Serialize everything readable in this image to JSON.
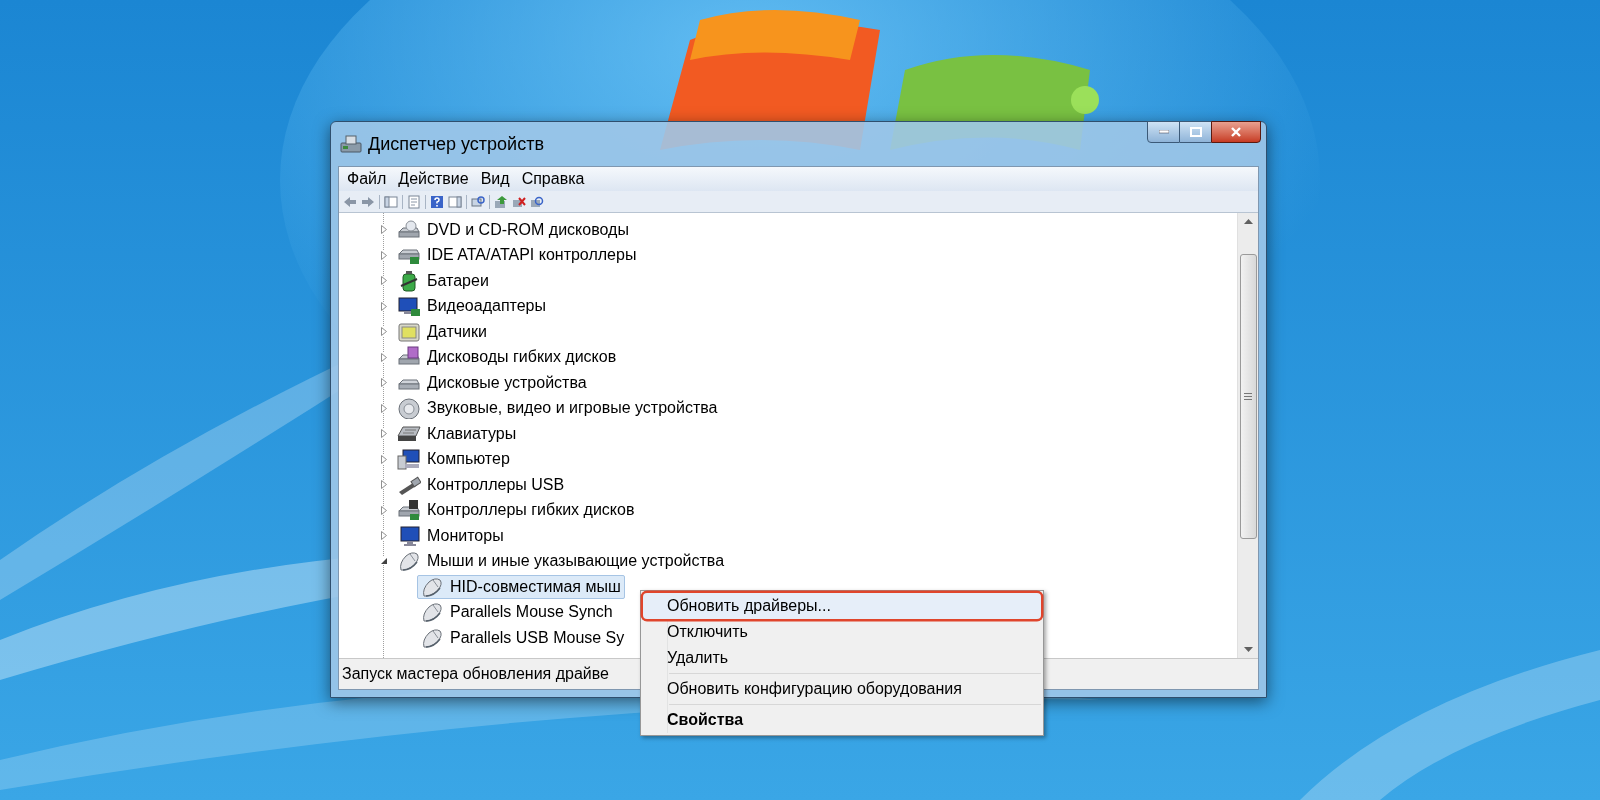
{
  "window": {
    "title": "Диспетчер устройств"
  },
  "menu_bar": [
    "Файл",
    "Действие",
    "Вид",
    "Справка"
  ],
  "tree": {
    "items": [
      {
        "label": "DVD и CD-ROM дисководы",
        "expanded": false,
        "selected": false
      },
      {
        "label": "IDE ATA/ATAPI контроллеры",
        "expanded": false,
        "selected": false
      },
      {
        "label": "Батареи",
        "expanded": false,
        "selected": false
      },
      {
        "label": "Видеоадаптеры",
        "expanded": false,
        "selected": false
      },
      {
        "label": "Датчики",
        "expanded": false,
        "selected": false
      },
      {
        "label": "Дисководы гибких дисков",
        "expanded": false,
        "selected": false
      },
      {
        "label": "Дисковые устройства",
        "expanded": false,
        "selected": false
      },
      {
        "label": "Звуковые, видео и игровые устройства",
        "expanded": false,
        "selected": false
      },
      {
        "label": "Клавиатуры",
        "expanded": false,
        "selected": false
      },
      {
        "label": "Компьютер",
        "expanded": false,
        "selected": false
      },
      {
        "label": "Контроллеры USB",
        "expanded": false,
        "selected": false
      },
      {
        "label": "Контроллеры гибких дисков",
        "expanded": false,
        "selected": false
      },
      {
        "label": "Мониторы",
        "expanded": false,
        "selected": false
      },
      {
        "label": "Мыши и иные указывающие устройства",
        "expanded": true,
        "selected": false,
        "children": [
          {
            "label": "HID-совместимая мыш",
            "selected": true
          },
          {
            "label": "Parallels Mouse Synch",
            "selected": false
          },
          {
            "label": "Parallels USB Mouse Sy",
            "selected": false
          }
        ]
      }
    ]
  },
  "status_bar": "Запуск мастера обновления драйве",
  "context_menu": {
    "groups": [
      [
        {
          "label": "Обновить драйверы...",
          "selected": true,
          "default": false
        },
        {
          "label": "Отключить",
          "selected": false,
          "default": false
        },
        {
          "label": "Удалить",
          "selected": false,
          "default": false
        }
      ],
      [
        {
          "label": "Обновить конфигурацию оборудования",
          "selected": false,
          "default": false
        }
      ],
      [
        {
          "label": "Свойства",
          "selected": false,
          "default": true
        }
      ]
    ]
  }
}
